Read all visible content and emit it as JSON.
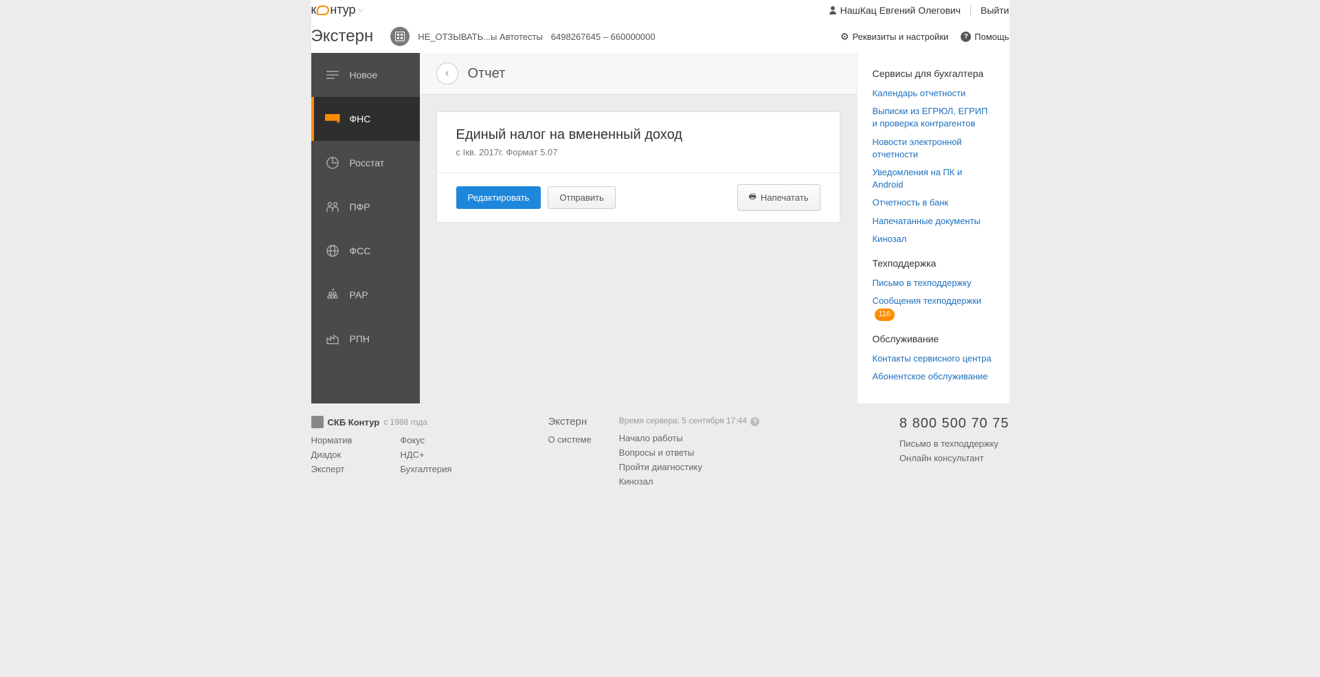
{
  "topbar": {
    "logo_left": "к",
    "logo_right": "нтур",
    "user": "НашКац Евгений Олегович",
    "logout": "Выйти"
  },
  "header": {
    "title": "Экстерн",
    "org_name": "НЕ_ОТЗЫВАТЬ...ы Автотесты",
    "org_codes": "6498267645 – 660000000",
    "settings": "Реквизиты и настройки",
    "help": "Помощь"
  },
  "sidebar": {
    "items": [
      {
        "label": "Новое"
      },
      {
        "label": "ФНС"
      },
      {
        "label": "Росстат"
      },
      {
        "label": "ПФР"
      },
      {
        "label": "ФСС"
      },
      {
        "label": "РАР"
      },
      {
        "label": "РПН"
      }
    ]
  },
  "content": {
    "page_title": "Отчет",
    "report_title": "Единый налог на вмененный доход",
    "report_sub": "с Iкв. 2017г. Формат 5.07",
    "edit_btn": "Редактировать",
    "send_btn": "Отправить",
    "print_btn": "Напечатать"
  },
  "rightbar": {
    "section1_title": "Сервисы для бухгалтера",
    "links1": [
      "Календарь отчетности",
      "Выписки из ЕГРЮЛ, ЕГРИП и проверка контрагентов",
      "Новости электронной отчетности",
      "Уведомления на ПК и Android",
      "Отчетность в банк",
      "Напечатанные документы",
      "Кинозал"
    ],
    "section2_title": "Техподдержка",
    "links2_0": "Письмо в техподдержку",
    "links2_1": "Сообщения техподдержки",
    "badge": "116",
    "section3_title": "Обслуживание",
    "links3": [
      "Контакты сервисного центра",
      "Абонентское обслуживание"
    ]
  },
  "footer": {
    "logo_text": "СКБ Контур",
    "since": "с 1988 года",
    "col1": [
      "Норматив",
      "Диадок",
      "Эксперт"
    ],
    "col2": [
      "Фокус",
      "НДС+",
      "Бухгалтерия"
    ],
    "extern": "Экстерн",
    "server_time": "Время сервера: 5 сентября 17:44",
    "about": "О системе",
    "col3": [
      "Начало работы",
      "Вопросы и ответы",
      "Пройти диагностику",
      "Кинозал"
    ],
    "phone": "8 800 500 70 75",
    "support_link": "Письмо в техподдержку",
    "consultant": "Онлайн консультант"
  }
}
